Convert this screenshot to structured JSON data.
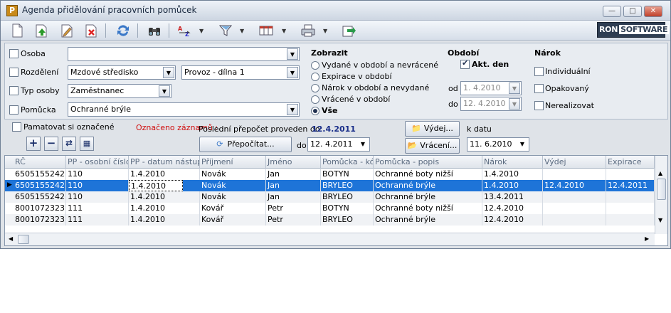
{
  "window": {
    "title": "Agenda přidělování pracovních pomůcek",
    "app_icon_letter": "P"
  },
  "logo": {
    "left": "RON",
    "right": "SOFTWARE"
  },
  "filters": {
    "osoba": {
      "label": "Osoba",
      "value": ""
    },
    "rozdeleni": {
      "label": "Rozdělení",
      "value1": "Mzdové středisko",
      "value2": "Provoz - dílna 1"
    },
    "typ_osoby": {
      "label": "Typ osoby",
      "value": "Zaměstnanec"
    },
    "pomucka": {
      "label": "Pomůcka",
      "value": "Ochranné brýle"
    }
  },
  "zobrazit": {
    "heading": "Zobrazit",
    "options": [
      "Vydané v období a nevrácené",
      "Expirace v období",
      "Nárok v období a nevydané",
      "Vrácené v období",
      "Vše"
    ],
    "selected": 4
  },
  "obdobi": {
    "heading": "Období",
    "akt_den": "Akt. den",
    "od_label": "od",
    "od_value": "1.  4.2010",
    "do_label": "do",
    "do_value": "12.  4.2010"
  },
  "narok": {
    "heading": "Nárok",
    "options": [
      "Individuální",
      "Opakovaný",
      "Nerealizovat"
    ]
  },
  "strip": {
    "remember": "Pamatovat si označené",
    "marked": "Označeno záznamů :",
    "last_recalc_label": "Poslední přepočet proveden do:",
    "last_recalc_value": "12.4.2011",
    "recalc_button": "Přepočítat...",
    "do_label": "do",
    "do_value": "12.  4.2011",
    "vydej_button": "Výdej...",
    "vraceni_button": "Vrácení...",
    "k_datu_label": "k datu",
    "k_datu_value": "11.  6.2010"
  },
  "grid": {
    "columns": [
      "RČ",
      "PP - osobní číslo",
      "PP - datum nástupu",
      "Příjmení",
      "Jméno",
      "Pomůcka - kód",
      "Pomůcka - popis",
      "Nárok",
      "Výdej",
      "Expirace"
    ],
    "rows": [
      [
        "6505155242",
        "110",
        "1.4.2010",
        "Novák",
        "Jan",
        "BOTYN",
        "Ochranné boty nižší",
        "1.4.2010",
        "",
        ""
      ],
      [
        "6505155242",
        "110",
        "1.4.2010",
        "Novák",
        "Jan",
        "BRYLEO",
        "Ochranné brýle",
        "1.4.2010",
        "12.4.2010",
        "12.4.2011"
      ],
      [
        "6505155242",
        "110",
        "1.4.2010",
        "Novák",
        "Jan",
        "BRYLEO",
        "Ochranné brýle",
        "13.4.2011",
        "",
        ""
      ],
      [
        "8001072323",
        "111",
        "1.4.2010",
        "Kovář",
        "Petr",
        "BOTYN",
        "Ochranné boty nižší",
        "12.4.2010",
        "",
        ""
      ],
      [
        "8001072323",
        "111",
        "1.4.2010",
        "Kovář",
        "Petr",
        "BRYLEO",
        "Ochranné brýle",
        "12.4.2010",
        "",
        ""
      ]
    ],
    "selected_row": 1
  },
  "colors": {
    "selection": "#1e74d8",
    "recalc_date": "#1a2f8a",
    "marked_label": "#d01010"
  }
}
